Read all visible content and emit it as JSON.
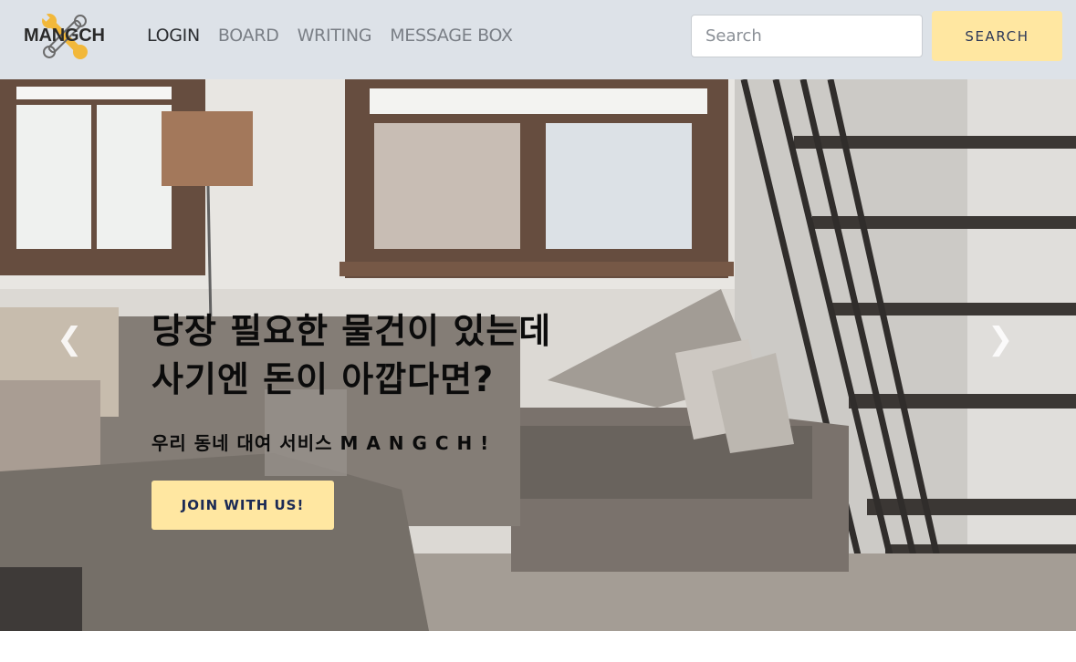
{
  "brand": {
    "logo_text": "MANGCH"
  },
  "nav": {
    "links": [
      {
        "label": "LOGIN"
      },
      {
        "label": "BOARD"
      },
      {
        "label": "WRITING"
      },
      {
        "label": "MESSAGE BOX"
      }
    ]
  },
  "search": {
    "placeholder": "Search",
    "value": "",
    "button_label": "SEARCH"
  },
  "hero": {
    "headline_line1": "당장 필요한 물건이 있는데",
    "headline_line2": "사기엔 돈이 아깝다면?",
    "subline": "우리 동네 대여 서비스 M A N G C H !",
    "cta_label": "JOIN WITH US!",
    "prev_icon": "chevron-left-icon",
    "next_icon": "chevron-right-icon"
  },
  "colors": {
    "navbar_bg": "#dde2e8",
    "accent_button": "#ffe7a1",
    "button_text": "#2c3858",
    "logo_accent": "#f2b83a"
  }
}
